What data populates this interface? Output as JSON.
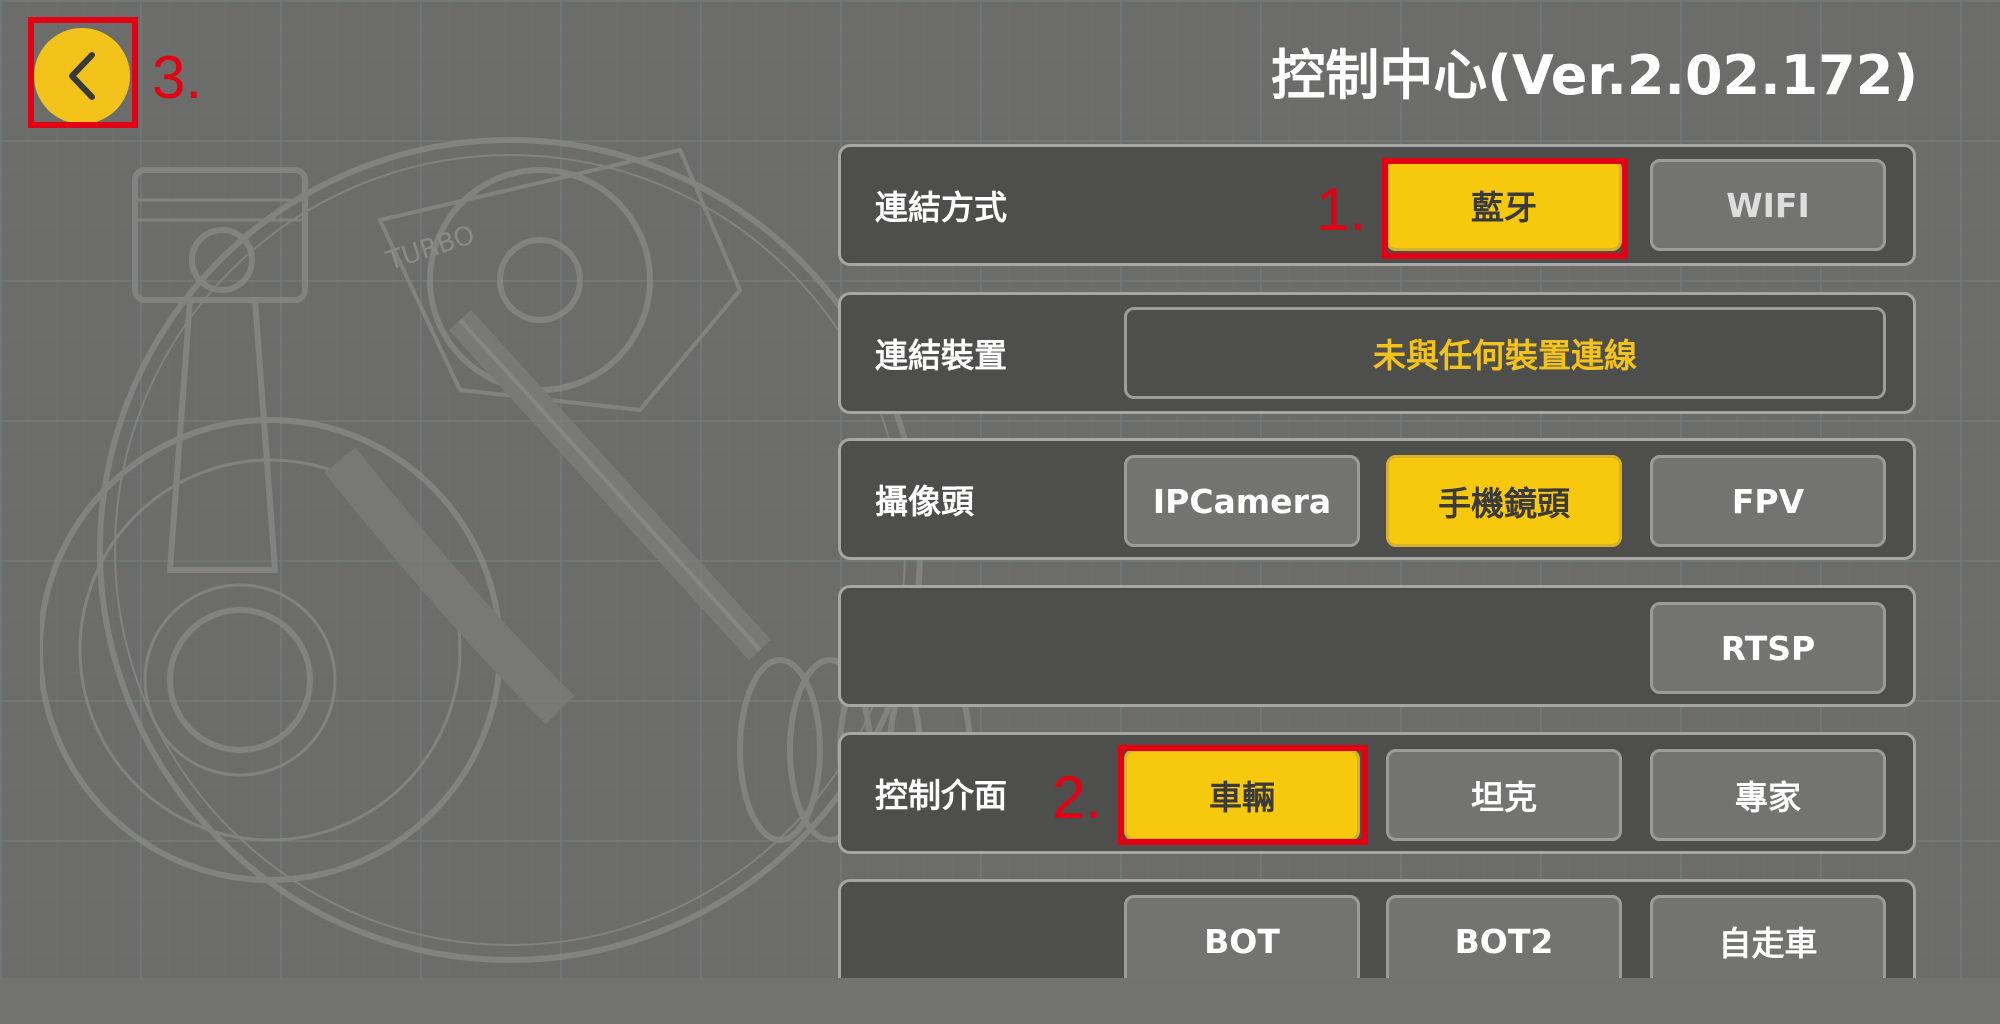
{
  "header": {
    "title": "控制中心(Ver.2.02.172)"
  },
  "annotations": {
    "step1": "1.",
    "step2": "2.",
    "step3": "3."
  },
  "rows": {
    "connection": {
      "label": "連結方式",
      "options": [
        "藍牙",
        "WIFI"
      ],
      "selected": "藍牙"
    },
    "device": {
      "label": "連結裝置",
      "value": "未與任何裝置連線"
    },
    "camera": {
      "label": "攝像頭",
      "options": [
        "IPCamera",
        "手機鏡頭",
        "FPV",
        "RTSP"
      ],
      "selected": "手機鏡頭"
    },
    "control": {
      "label": "控制介面",
      "options": [
        "車輛",
        "坦克",
        "專家",
        "BOT",
        "BOT2",
        "自走車"
      ],
      "selected": "車輛"
    }
  },
  "background_art_text": "TURBO",
  "colors": {
    "accent_yellow": "#f6c80e",
    "annotation_red": "#e40012",
    "panel": "#4e4e4c",
    "button": "#737372"
  },
  "icons": {
    "back": "chevron-left-icon"
  }
}
